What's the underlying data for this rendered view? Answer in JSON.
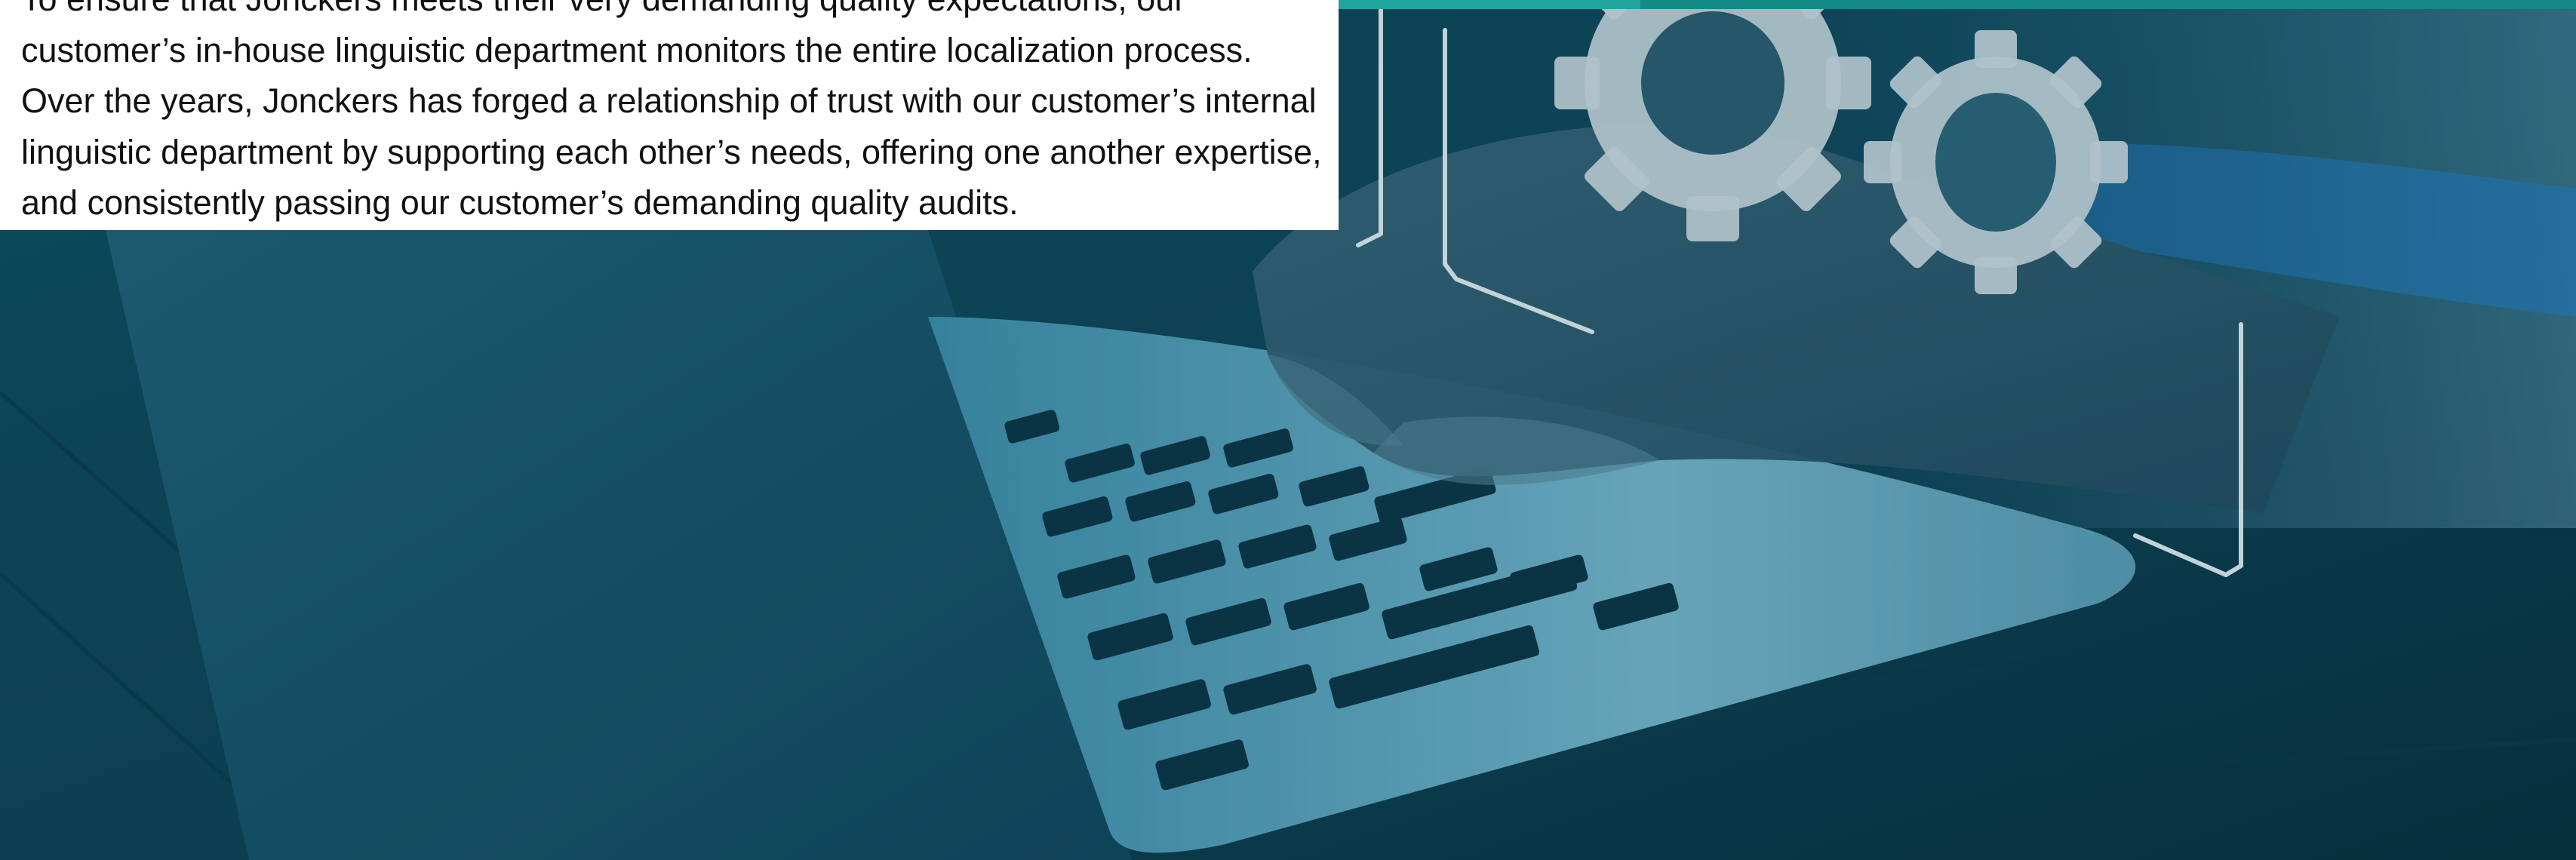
{
  "paragraph": {
    "lines": [
      "To ensure that Jonckers meets their very demanding quality expectations, our",
      "customer’s in-house linguistic department monitors the entire localization process.",
      "Over the years, Jonckers has forged a relationship of trust with our customer’s internal",
      "linguistic department by supporting each other’s needs, offering one another expertise,",
      "and consistently passing our customer’s demanding quality audits."
    ]
  },
  "colors": {
    "accent_bar": "#138a84",
    "overlay_tint": "#0f3d4c",
    "text_box_bg": "#ffffff",
    "text": "#111111"
  },
  "photo": {
    "subject": "hands typing on laptop with gear icons overlay",
    "icons": [
      "gear-icon",
      "gear-icon"
    ]
  }
}
